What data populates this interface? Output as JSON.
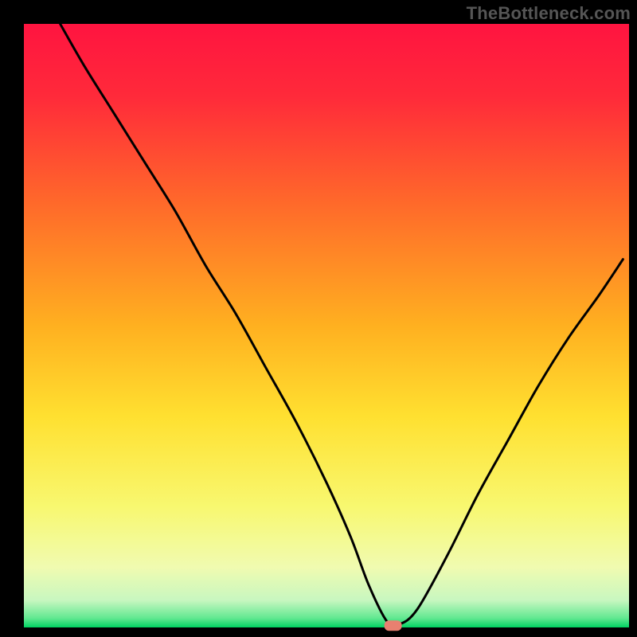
{
  "watermark": "TheBottleneck.com",
  "chart_data": {
    "type": "line",
    "title": "",
    "xlabel": "",
    "ylabel": "",
    "xlim": [
      0,
      100
    ],
    "ylim": [
      0,
      100
    ],
    "grid": false,
    "legend": false,
    "notes": "Bottleneck percentage curve. Minimum (~0%) reached near x≈60. Red marker at trough.",
    "x": [
      6,
      10,
      15,
      20,
      25,
      30,
      35,
      40,
      45,
      50,
      54,
      57,
      60,
      62,
      65,
      70,
      75,
      80,
      85,
      90,
      95,
      99
    ],
    "values": [
      100,
      93,
      85,
      77,
      69,
      60,
      52,
      43,
      34,
      24,
      15,
      7,
      1,
      0.5,
      3,
      12,
      22,
      31,
      40,
      48,
      55,
      61
    ],
    "marker": {
      "x": 61,
      "y": 0.3
    },
    "gradient_stops": [
      {
        "offset": 0.0,
        "color": "#ff1440"
      },
      {
        "offset": 0.12,
        "color": "#ff2a3a"
      },
      {
        "offset": 0.3,
        "color": "#ff6a2a"
      },
      {
        "offset": 0.5,
        "color": "#ffb020"
      },
      {
        "offset": 0.65,
        "color": "#ffe030"
      },
      {
        "offset": 0.8,
        "color": "#f8f870"
      },
      {
        "offset": 0.9,
        "color": "#f0fbb0"
      },
      {
        "offset": 0.955,
        "color": "#c8f7c0"
      },
      {
        "offset": 0.985,
        "color": "#60e890"
      },
      {
        "offset": 1.0,
        "color": "#00d362"
      }
    ]
  }
}
